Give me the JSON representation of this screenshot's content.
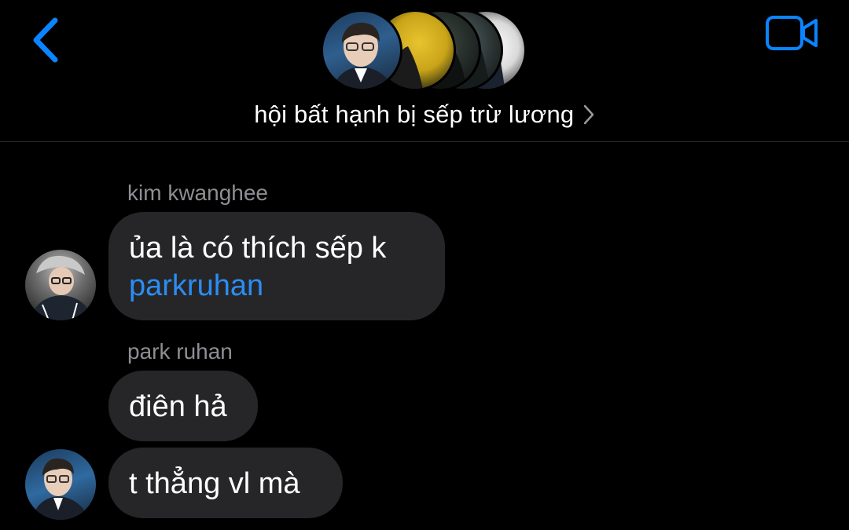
{
  "header": {
    "back_icon": "chevron-left-icon",
    "video_icon": "video-camera-icon",
    "group_title": "hội bất hạnh bị sếp trừ lương",
    "title_chevron_icon": "chevron-right-icon",
    "accent_color": "#0a84ff"
  },
  "messages": [
    {
      "sender": "kim kwanghee",
      "text": "ủa là có thích sếp k",
      "mention": "parkruhan"
    },
    {
      "sender": "park ruhan",
      "text": "điên hả"
    },
    {
      "text": "t thẳng vl mà"
    }
  ],
  "colors": {
    "background": "#000000",
    "bubble": "#262628",
    "sender_name": "#8e8e93",
    "mention": "#2b8df4"
  }
}
